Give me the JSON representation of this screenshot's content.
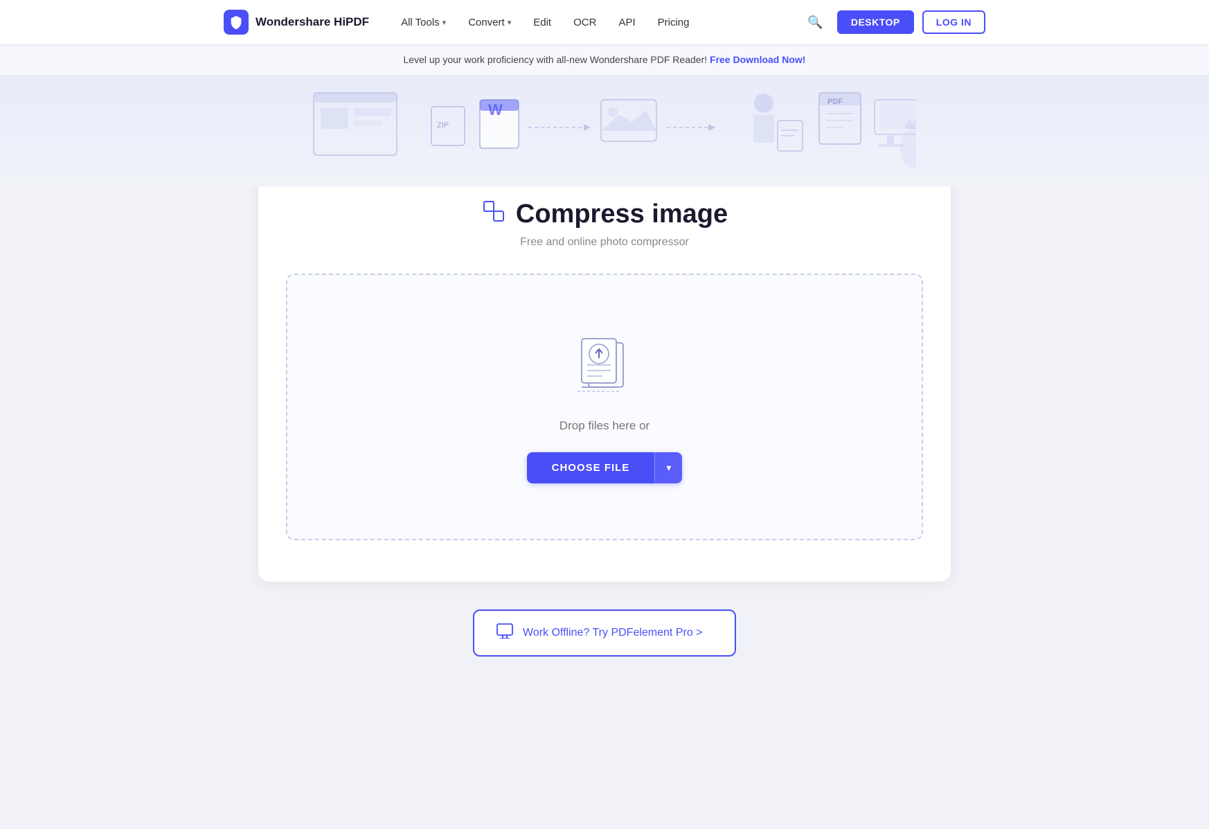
{
  "brand": {
    "name": "Wondershare HiPDF",
    "logo_alt": "HiPDF logo"
  },
  "nav": {
    "all_tools_label": "All Tools",
    "convert_label": "Convert",
    "edit_label": "Edit",
    "ocr_label": "OCR",
    "api_label": "API",
    "pricing_label": "Pricing",
    "desktop_button": "DESKTOP",
    "login_button": "LOG IN"
  },
  "banner": {
    "text": "Level up your work proficiency with all-new Wondershare PDF Reader!",
    "link_text": "Free Download Now!"
  },
  "tool": {
    "title": "Compress image",
    "subtitle": "Free and online photo compressor",
    "title_icon": "compress-icon"
  },
  "dropzone": {
    "upload_icon": "upload-icon",
    "drop_text": "Drop files here or",
    "choose_file_label": "CHOOSE FILE",
    "dropdown_arrow": "▾"
  },
  "offline": {
    "icon": "monitor-icon",
    "text": "Work Offline? Try PDFelement Pro >",
    "arrow": ">"
  },
  "colors": {
    "brand_blue": "#4a4ef7",
    "text_dark": "#1a1a2e",
    "text_gray": "#888888",
    "border_dashed": "#c8cce8"
  }
}
